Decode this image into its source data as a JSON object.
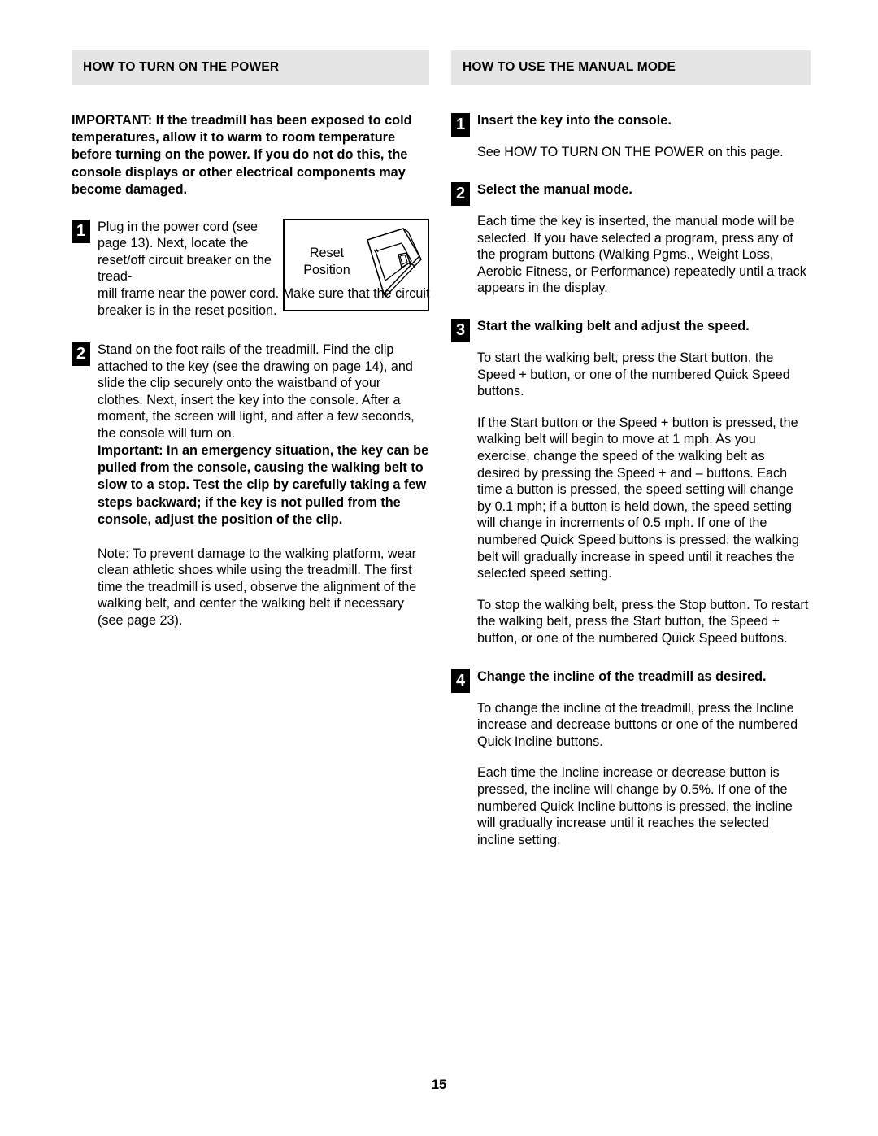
{
  "page": {
    "number": "15"
  },
  "left_column": {
    "header": "HOW TO TURN ON THE POWER",
    "important_notice": "IMPORTANT: If the treadmill has been exposed to cold temperatures, allow it to warm to room temperature before turning on the power. If you do not do this, the console displays or other electrical components may become damaged.",
    "steps": [
      {
        "number": "1",
        "text_narrow": "Plug in the power cord (see page 13). Next, locate the reset/off circuit breaker on the tread-",
        "text_full": "mill frame near the power cord. Make sure that the circuit breaker is in the reset position."
      },
      {
        "number": "2",
        "text": "Stand on the foot rails of the treadmill. Find the clip attached to the key (see the drawing on page 14), and slide the clip securely onto the waistband of your clothes. Next, insert the key into the console. After a moment, the screen will light, and after a few seconds, the console will turn on.",
        "bold_text": "Important: In an emergency situation, the key can be pulled from the console, causing the walking belt to slow to a stop. Test the clip by carefully taking a few steps backward; if the key is not pulled from the console, adjust the position of the clip.",
        "note": "Note: To prevent damage to the walking platform, wear clean athletic shoes while using the treadmill. The first time the treadmill is used, observe the alignment of the walking belt, and center the walking belt if necessary (see page 23)."
      }
    ],
    "figure": {
      "label_line1": "Reset",
      "label_line2": "Position",
      "caption": "circuit-breaker-reset-position-diagram"
    }
  },
  "right_column": {
    "header": "HOW TO USE THE MANUAL MODE",
    "steps": [
      {
        "number": "1",
        "title": "Insert the key into the console.",
        "paragraphs": [
          "See HOW TO TURN ON THE POWER on this page."
        ]
      },
      {
        "number": "2",
        "title": "Select the manual mode.",
        "paragraphs": [
          "Each time the key is inserted, the manual mode will be selected. If you have selected a program, press any of the program buttons (Walking Pgms., Weight Loss, Aerobic Fitness, or Performance) repeatedly until a track appears in the display."
        ]
      },
      {
        "number": "3",
        "title": "Start the walking belt and adjust the speed.",
        "paragraphs": [
          "To start the walking belt, press the Start button, the Speed + button, or one of the numbered Quick Speed buttons.",
          "If the Start button or the Speed + button is pressed, the walking belt will begin to move at 1 mph. As you exercise, change the speed of the walking belt as desired by pressing the Speed + and – buttons. Each time a button is pressed, the speed setting will change by 0.1 mph; if a button is held down, the speed setting will change in increments of 0.5 mph. If one of the numbered Quick Speed buttons is pressed, the walking belt will gradually increase in speed until it reaches the selected speed setting.",
          "To stop the walking belt, press the Stop button. To restart the walking belt, press the Start button, the Speed + button, or one of the numbered Quick Speed buttons."
        ]
      },
      {
        "number": "4",
        "title": "Change the incline of the treadmill as desired.",
        "paragraphs": [
          "To change the incline of the treadmill, press the Incline increase and decrease buttons or one of the numbered Quick Incline buttons.",
          "Each time the Incline increase or decrease button is pressed, the incline will change by 0.5%. If one of the numbered Quick Incline buttons is pressed, the incline will gradually increase until it reaches the selected incline setting."
        ]
      }
    ]
  },
  "colors": {
    "header_background": "#e5e5e5",
    "badge_background": "#000000",
    "badge_text": "#ffffff",
    "body_text": "#000000",
    "page_background": "#ffffff"
  }
}
